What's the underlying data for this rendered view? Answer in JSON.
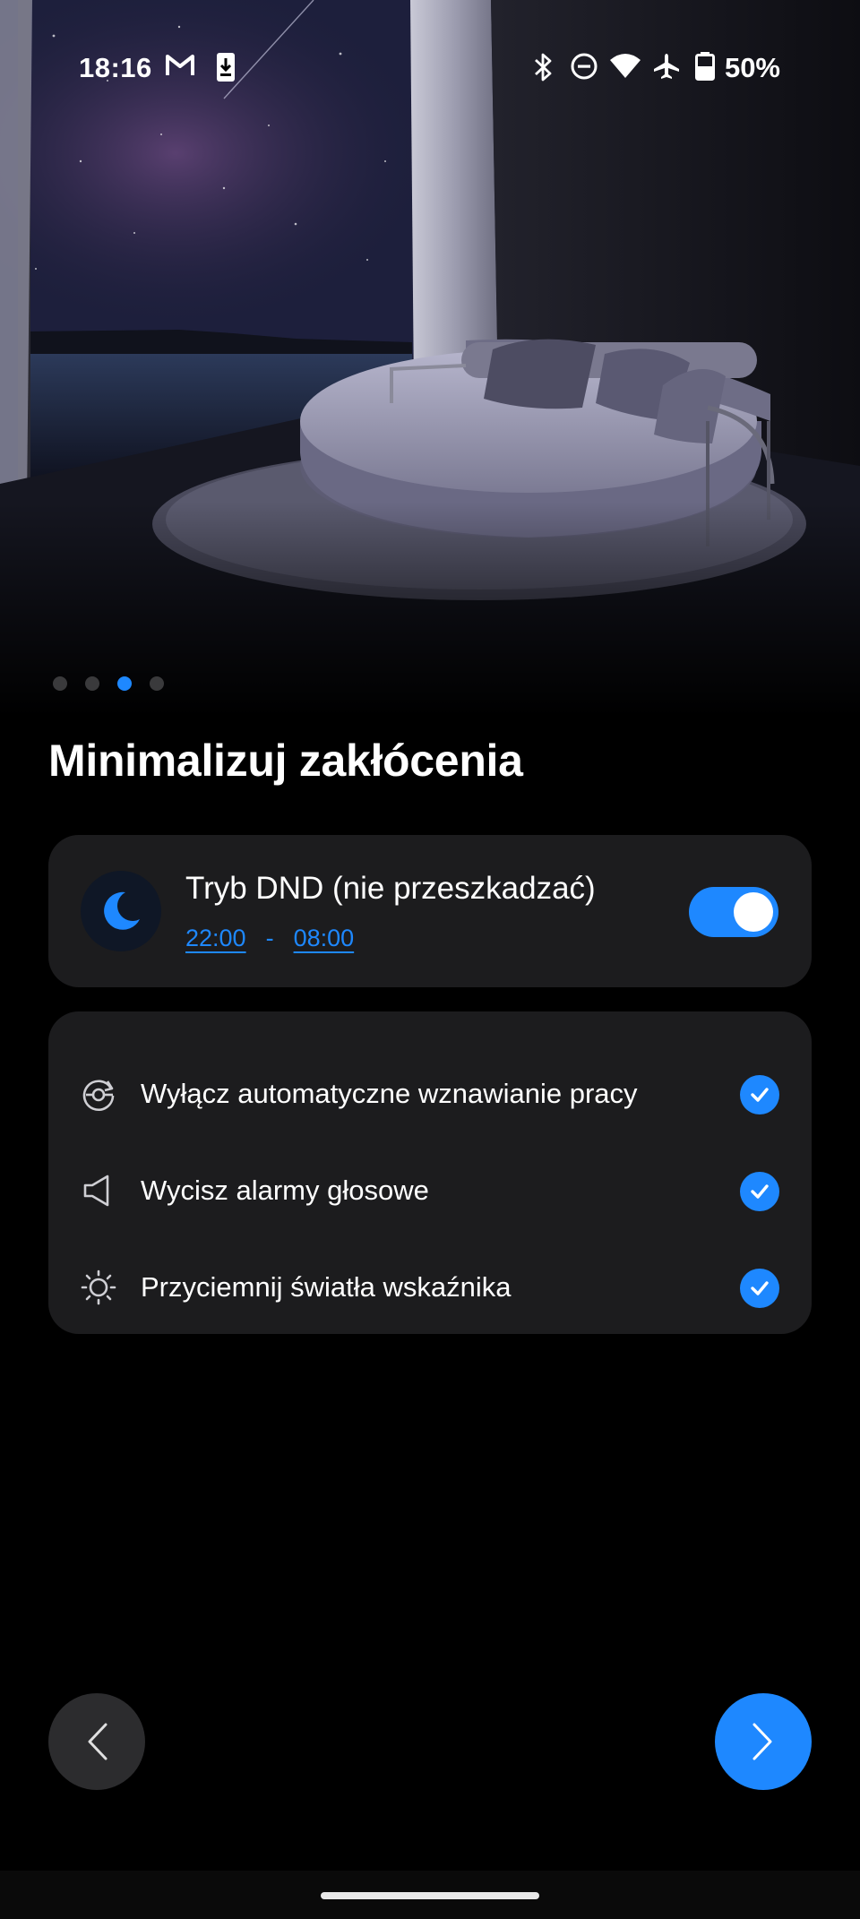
{
  "status_bar": {
    "time": "18:16",
    "battery": "50%",
    "icons": [
      "gmail-icon",
      "download-icon",
      "bluetooth-icon",
      "dnd-icon",
      "wifi-icon",
      "airplane-icon",
      "battery-icon"
    ]
  },
  "pager": {
    "total": 4,
    "active_index": 2
  },
  "title": "Minimalizuj zakłócenia",
  "dnd": {
    "label": "Tryb DND (nie przeszkadzać)",
    "start": "22:00",
    "separator": "-",
    "end": "08:00",
    "enabled": true,
    "icon": "moon-icon"
  },
  "options": [
    {
      "label": "Wyłącz automatyczne wznawianie pracy",
      "icon": "auto-resume-icon",
      "checked": true
    },
    {
      "label": "Wycisz alarmy głosowe",
      "icon": "speaker-icon",
      "checked": true
    },
    {
      "label": "Przyciemnij światła wskaźnika",
      "icon": "brightness-icon",
      "checked": true
    }
  ],
  "colors": {
    "accent": "#1e88ff",
    "card": "#1c1c1e",
    "background": "#000000"
  }
}
